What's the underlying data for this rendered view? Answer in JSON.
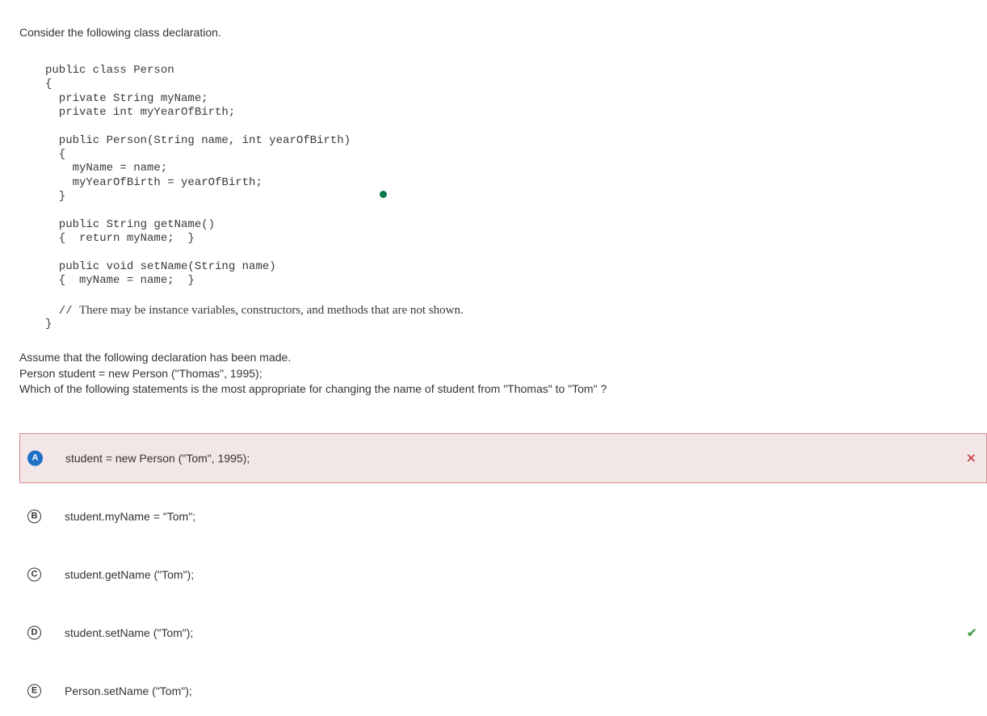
{
  "intro": "Consider the following class declaration.",
  "code": {
    "lines": [
      "public class Person",
      "{",
      "  private String myName;",
      "  private int myYearOfBirth;",
      "  public Person(String name, int yearOfBirth)",
      "  {",
      "    myName = name;",
      "    myYearOfBirth = yearOfBirth;",
      "  }",
      "  public String getName()",
      "  {  return myName;  }",
      "  public void setName(String name)",
      "  {  myName = name;  }",
      "  // ",
      "}"
    ],
    "comment": "There may be instance variables, constructors, and methods that are not shown."
  },
  "question": {
    "line1": "Assume that the following declaration has been made.",
    "line2": "Person student = new Person (\"Thomas\", 1995);",
    "line3": "Which of the following statements is the most appropriate for changing the name of student from \"Thomas\" to \"Tom\" ?"
  },
  "options": [
    {
      "letter": "A",
      "text": "student = new Person (\"Tom\", 1995);",
      "status": "selected-wrong"
    },
    {
      "letter": "B",
      "text": "student.myName = \"Tom\";",
      "status": "none"
    },
    {
      "letter": "C",
      "text": "student.getName (\"Tom\");",
      "status": "none"
    },
    {
      "letter": "D",
      "text": "student.setName (\"Tom\");",
      "status": "correct"
    },
    {
      "letter": "E",
      "text": "Person.setName (\"Tom\");",
      "status": "none"
    }
  ],
  "icons": {
    "wrong": "close-icon",
    "correct": "check-icon"
  },
  "colors": {
    "selected_bg": "#f3e6e7",
    "selected_border": "#d58c91",
    "selected_letter": "#1f6fc5",
    "wrong_mark": "#c8303a",
    "correct_mark": "#3a9a3a",
    "dot": "#0a7a4a"
  }
}
